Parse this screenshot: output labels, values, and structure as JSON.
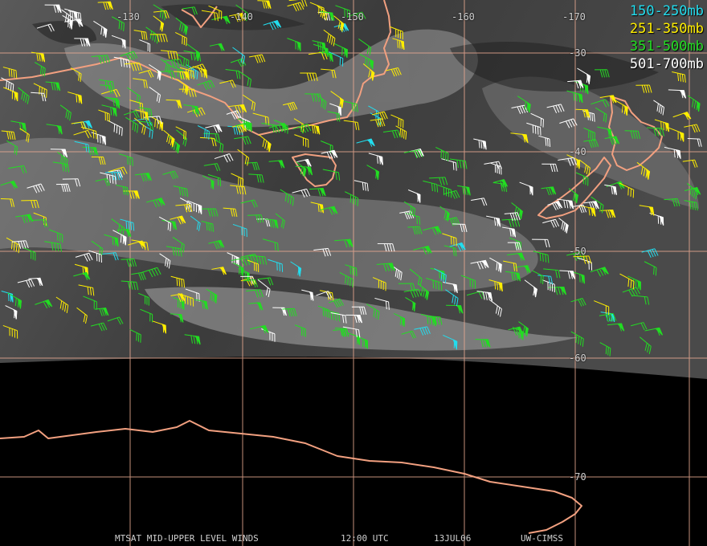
{
  "legend": [
    {
      "label": "150-250mb",
      "color": "#22ddee"
    },
    {
      "label": "251-350mb",
      "color": "#ffee00"
    },
    {
      "label": "351-500mb",
      "color": "#22dd22"
    },
    {
      "label": "501-700mb",
      "color": "#ffffff"
    }
  ],
  "longitude_labels": [
    "-130",
    "-140",
    "-150",
    "-160",
    "-170"
  ],
  "latitude_labels": [
    "-30",
    "-40",
    "-50",
    "-60",
    "-70"
  ],
  "footer": {
    "product": "MTSAT MID-UPPER LEVEL WINDS",
    "time": "12:00 UTC",
    "date": "13JUL06",
    "source": "UW-CIMSS"
  },
  "colors": {
    "grid": "#e8a890",
    "coastline": "#f2a080",
    "space": "#000000"
  }
}
